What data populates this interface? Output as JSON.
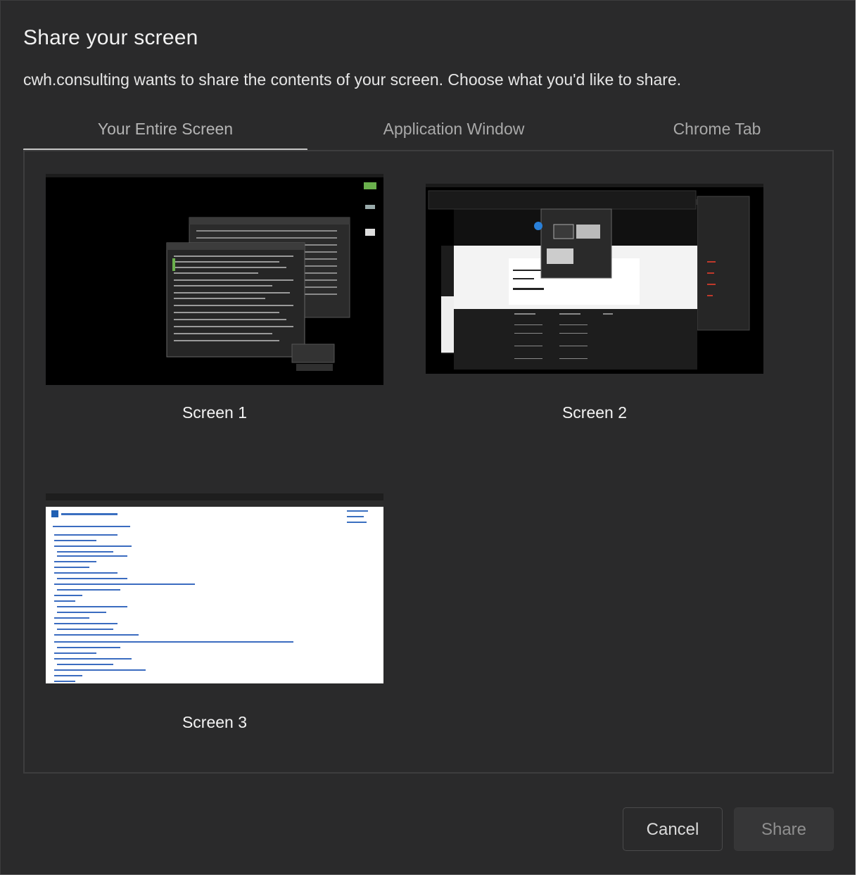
{
  "dialog": {
    "title": "Share your screen",
    "subtitle": "cwh.consulting wants to share the contents of your screen. Choose what you'd like to share."
  },
  "tabs": [
    {
      "label": "Your Entire Screen",
      "active": true
    },
    {
      "label": "Application Window",
      "active": false
    },
    {
      "label": "Chrome Tab",
      "active": false
    }
  ],
  "screens": [
    {
      "label": "Screen 1"
    },
    {
      "label": "Screen 2"
    },
    {
      "label": "Screen 3"
    }
  ],
  "buttons": {
    "cancel": "Cancel",
    "share": "Share"
  },
  "colors": {
    "background": "#2a2a2b",
    "text": "#f1f1f1",
    "tab_inactive": "#a9a9a9",
    "share_disabled_text": "#8f8f8f"
  }
}
